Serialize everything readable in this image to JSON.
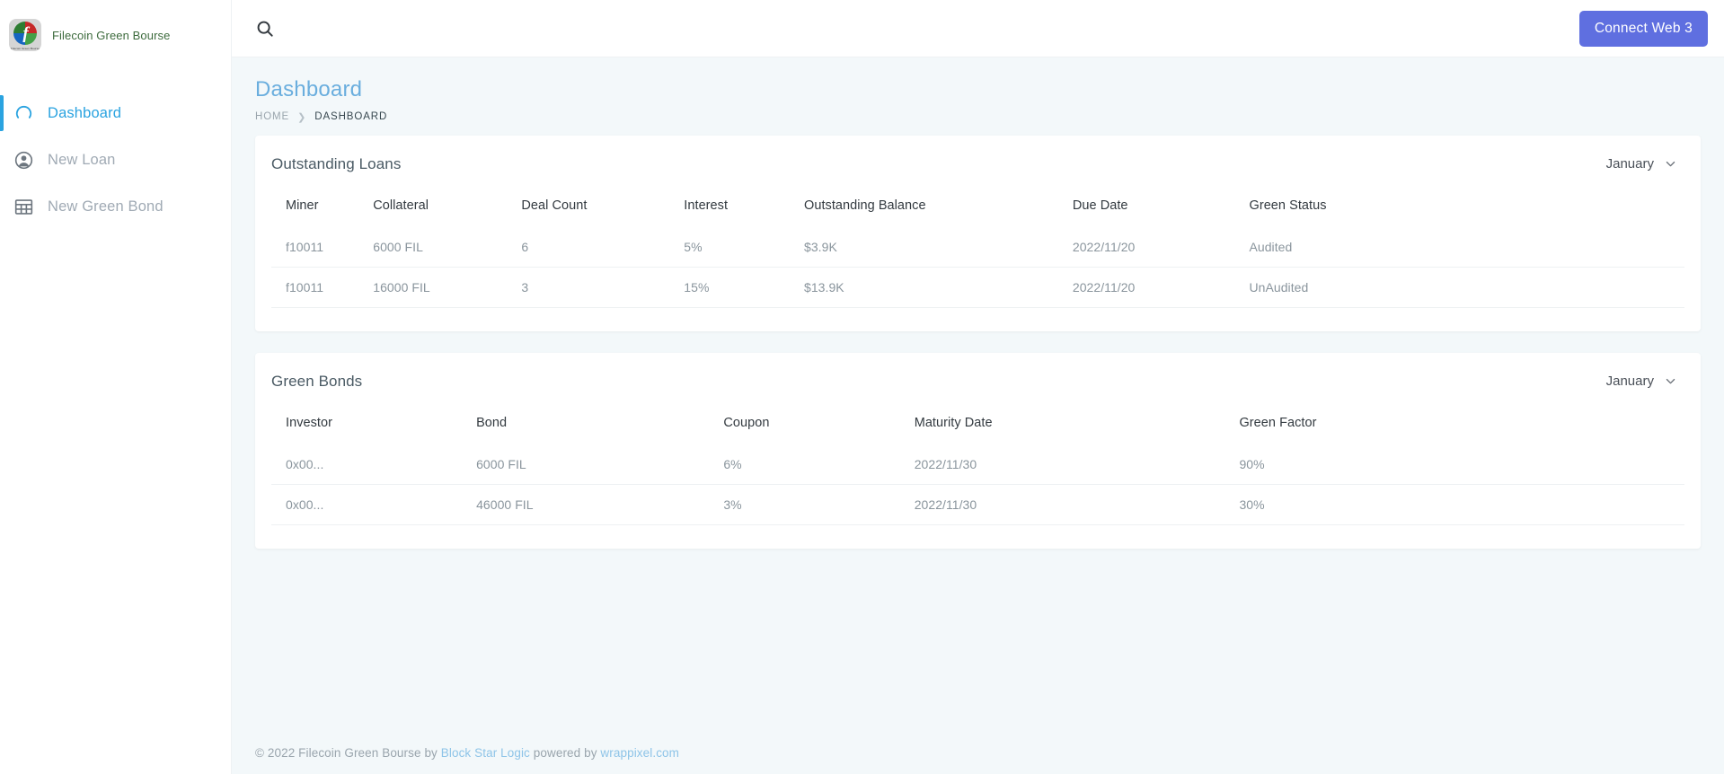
{
  "brand": {
    "name": "Filecoin Green Bourse",
    "logo_icon": "filecoin-logo-icon",
    "logo_caption": "Filecoin Green Bourse"
  },
  "sidebar": {
    "items": [
      {
        "label": "Dashboard",
        "icon": "speedometer-icon",
        "active": true
      },
      {
        "label": "New Loan",
        "icon": "user-circle-icon",
        "active": false
      },
      {
        "label": "New Green Bond",
        "icon": "grid-table-icon",
        "active": false
      }
    ]
  },
  "topbar": {
    "search_icon": "search-icon",
    "connect_label": "Connect Web 3"
  },
  "page": {
    "title": "Dashboard",
    "breadcrumb": {
      "home": "HOME",
      "separator": "❯",
      "current": "DASHBOARD"
    }
  },
  "loans_card": {
    "title": "Outstanding Loans",
    "month": "January",
    "chevron_icon": "chevron-down-icon",
    "columns": [
      "Miner",
      "Collateral",
      "Deal Count",
      "Interest",
      "Outstanding Balance",
      "Due Date",
      "Green Status"
    ],
    "rows": [
      [
        "f10011",
        "6000 FIL",
        "6",
        "5%",
        "$3.9K",
        "2022/11/20",
        "Audited"
      ],
      [
        "f10011",
        "16000 FIL",
        "3",
        "15%",
        "$13.9K",
        "2022/11/20",
        "UnAudited"
      ]
    ]
  },
  "bonds_card": {
    "title": "Green Bonds",
    "month": "January",
    "chevron_icon": "chevron-down-icon",
    "columns": [
      "Investor",
      "Bond",
      "Coupon",
      "Maturity Date",
      "Green Factor"
    ],
    "rows": [
      [
        "0x00...",
        "6000 FIL",
        "6%",
        "2022/11/30",
        "90%"
      ],
      [
        "0x00...",
        "46000 FIL",
        "3%",
        "2022/11/30",
        "30%"
      ]
    ]
  },
  "footer": {
    "prefix": "© 2022 Filecoin Green Bourse by ",
    "link1": "Block Star Logic",
    "middle": " powered by ",
    "link2": "wrappixel.com"
  },
  "colors": {
    "accent_blue": "#2aa3e0",
    "title_blue": "#6aaede",
    "connect_purple": "#5f6fe0",
    "page_bg": "#f3f8fa",
    "link_blue": "#8ec4e8"
  }
}
